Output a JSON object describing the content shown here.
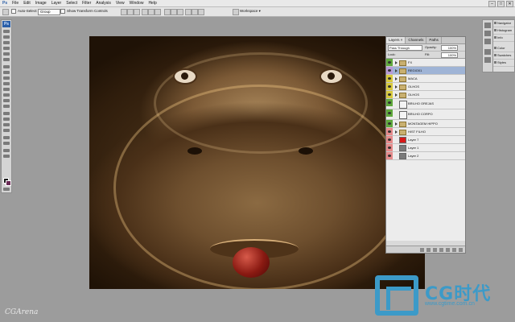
{
  "menubar": {
    "logo": "Ps",
    "items": [
      "File",
      "Edit",
      "Image",
      "Layer",
      "Select",
      "Filter",
      "Analysis",
      "View",
      "Window",
      "Help"
    ],
    "window_controls": [
      "–",
      "□",
      "✕"
    ]
  },
  "options_bar": {
    "auto_select_label": "Auto-Select:",
    "auto_select_value": "Group",
    "transform_label": "Show Transform Controls",
    "workspace_label": "Workspace ▾"
  },
  "layers_panel": {
    "tabs": [
      "Layers ×",
      "Channels",
      "Paths"
    ],
    "blend_mode": "Pass Through",
    "opacity_label": "Opacity:",
    "opacity_value": "100%",
    "lock_label": "Lock:",
    "fill_label": "Fill:",
    "fill_value": "100%",
    "layers": [
      {
        "name": "FX",
        "color": "#5fa83c",
        "kind": "folder"
      },
      {
        "name": "REGIO01",
        "color": "#b89ad6",
        "kind": "folder",
        "selected": true
      },
      {
        "name": "MACA",
        "color": "#d8c93e",
        "kind": "folder"
      },
      {
        "name": "OLHOS",
        "color": "#d8c93e",
        "kind": "folder"
      },
      {
        "name": "OLHOS",
        "color": "#d8c93e",
        "kind": "folder"
      },
      {
        "name": "BRILHO OREJAS",
        "color": "#5fa83c",
        "kind": "layer-mask"
      },
      {
        "name": "BRILHO CORPO",
        "color": "#5fa83c",
        "kind": "layer-mask"
      },
      {
        "name": "MONTAGEM HIPPO",
        "color": "#5fa83c",
        "kind": "folder"
      },
      {
        "name": "HIST FILHO",
        "color": "#e58a8a",
        "kind": "folder"
      },
      {
        "name": "Layer 7",
        "color": "#e58a8a",
        "kind": "red-thumb"
      },
      {
        "name": "Layer 1",
        "color": "#e58a8a",
        "kind": "thumb"
      },
      {
        "name": "Layer 2",
        "color": "#e58a8a",
        "kind": "thumb"
      }
    ]
  },
  "dock": {
    "items": [
      "Navigator",
      "Histogram",
      "Info",
      "Color",
      "Swatches",
      "Styles"
    ]
  },
  "watermark": {
    "brand": "CG时代",
    "url": "www.cgtime.com.cn",
    "arena": "CGArena"
  }
}
